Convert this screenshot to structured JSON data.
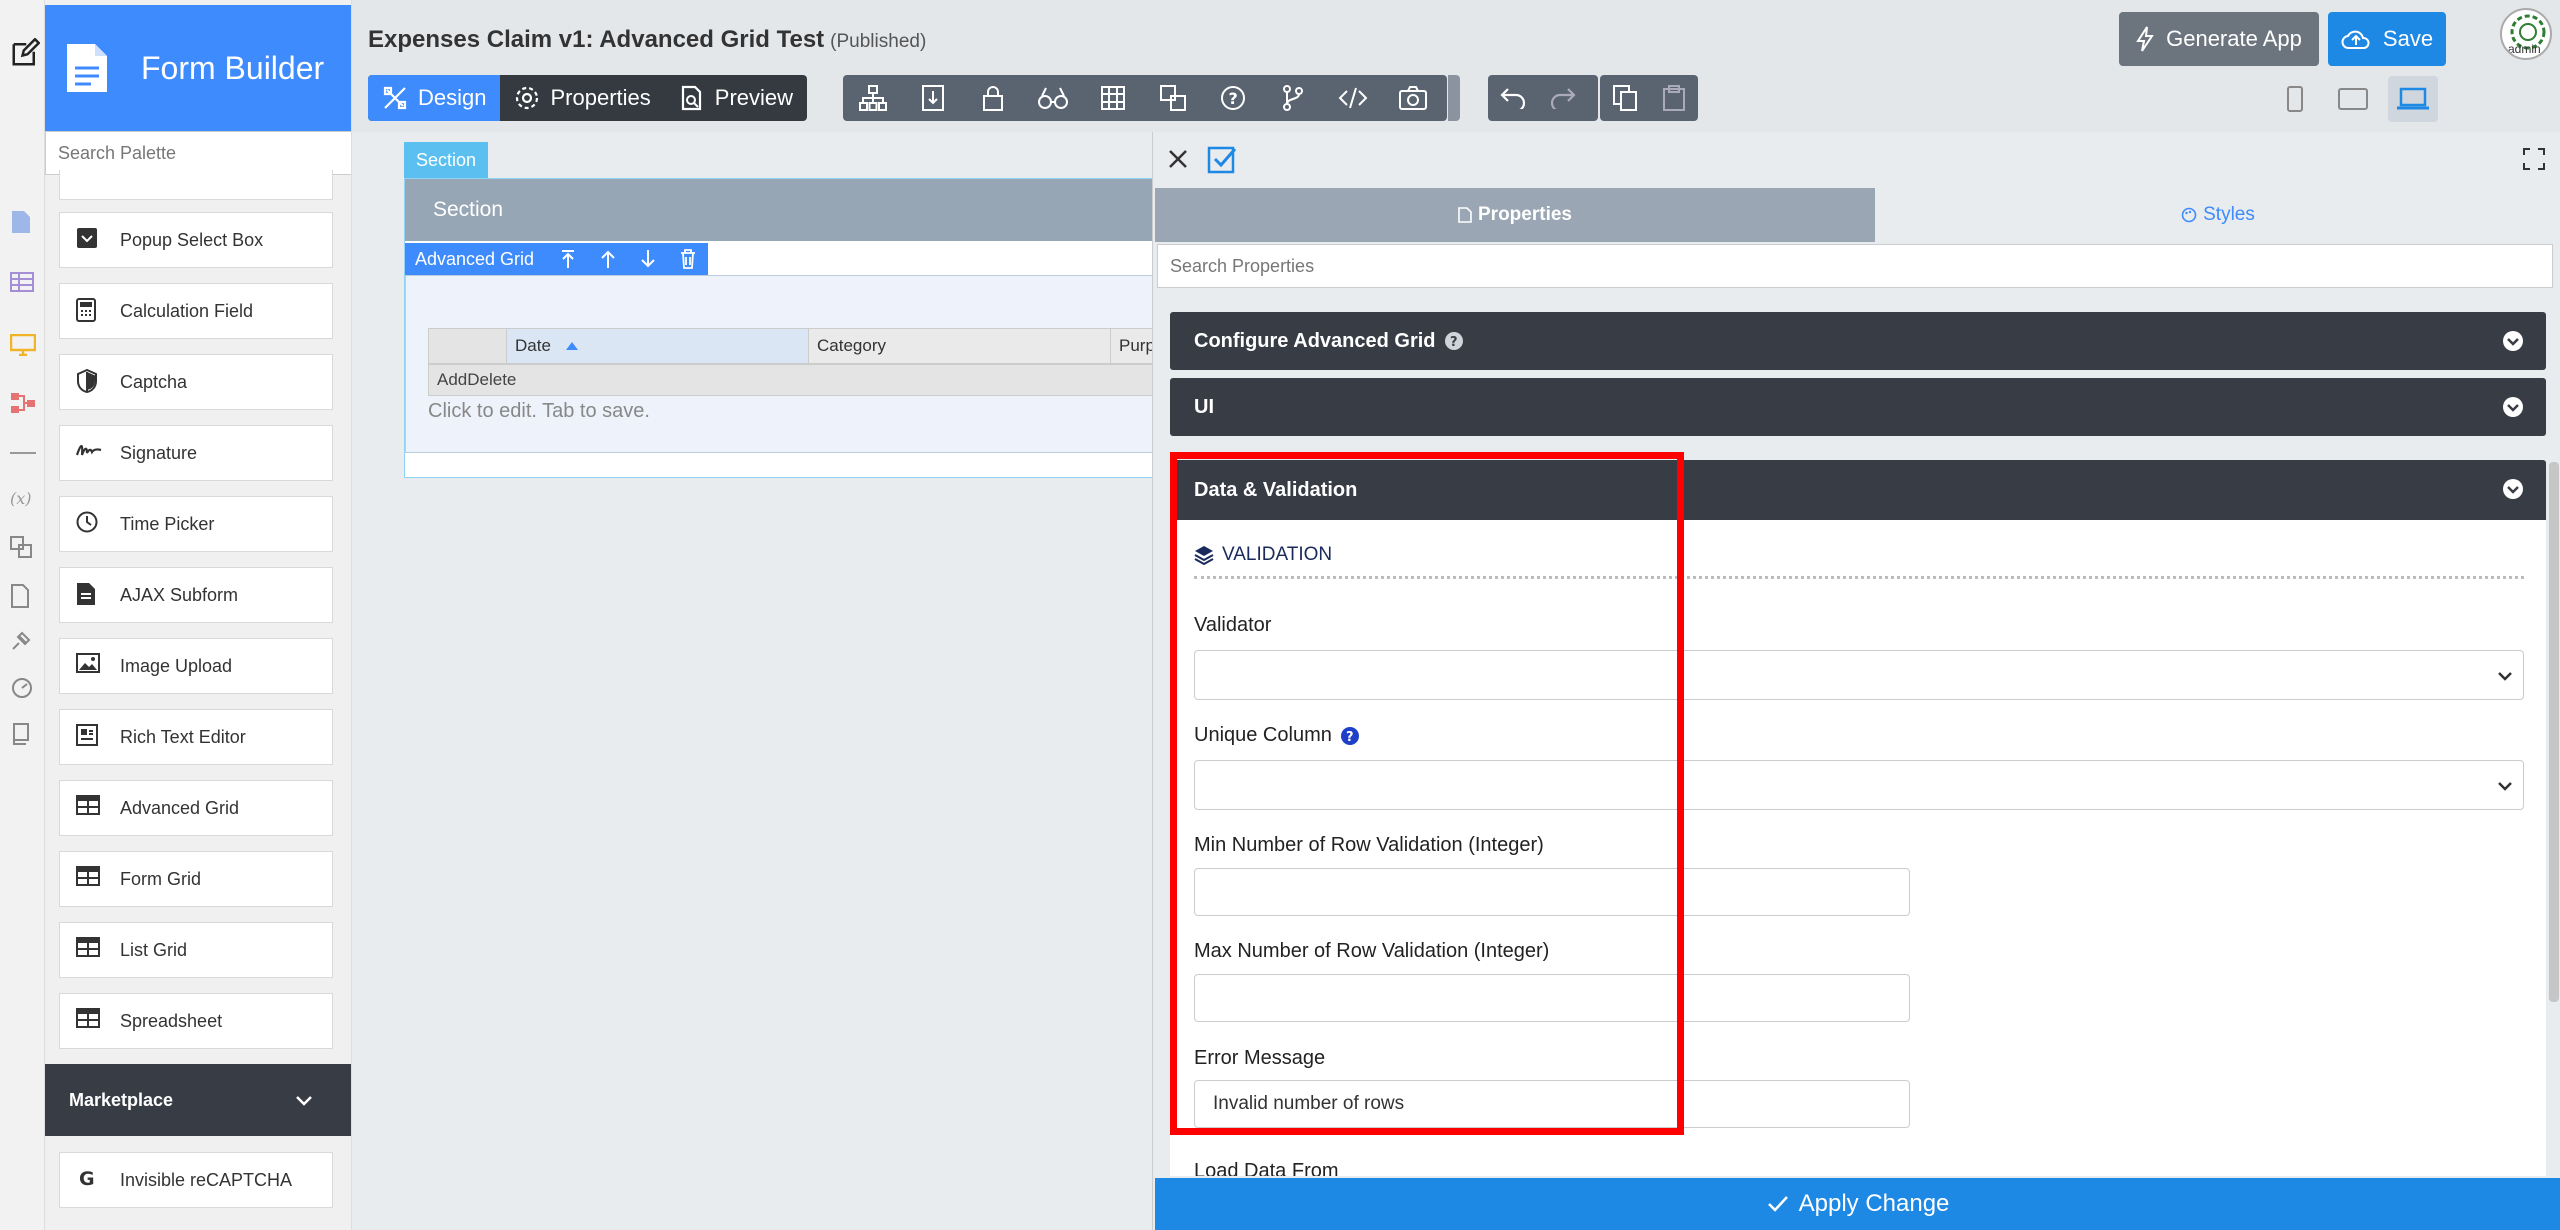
{
  "palette": {
    "title": "Form Builder",
    "search_placeholder": "Search Palette",
    "items": [
      {
        "label": "Popup Select Box",
        "icon": "popup-select-icon"
      },
      {
        "label": "Calculation Field",
        "icon": "calculator-icon"
      },
      {
        "label": "Captcha",
        "icon": "shield-icon"
      },
      {
        "label": "Signature",
        "icon": "signature-icon"
      },
      {
        "label": "Time Picker",
        "icon": "clock-icon"
      },
      {
        "label": "AJAX Subform",
        "icon": "file-icon"
      },
      {
        "label": "Image Upload",
        "icon": "image-icon"
      },
      {
        "label": "Rich Text Editor",
        "icon": "rich-text-icon"
      },
      {
        "label": "Advanced Grid",
        "icon": "table-icon"
      },
      {
        "label": "Form Grid",
        "icon": "table-icon"
      },
      {
        "label": "List Grid",
        "icon": "table-icon"
      },
      {
        "label": "Spreadsheet",
        "icon": "table-icon"
      }
    ],
    "marketplace_label": "Marketplace",
    "marketplace_items": [
      {
        "label": "Invisible reCAPTCHA",
        "icon": "google-icon"
      }
    ]
  },
  "header": {
    "title": "Expenses Claim v1: Advanced Grid Test",
    "status": "(Published)",
    "modes": [
      "Design",
      "Properties",
      "Preview"
    ],
    "generate_label": "Generate App",
    "save_label": "Save",
    "avatar_label": "admin"
  },
  "canvas": {
    "section_tab": "Section",
    "section_header": "Section",
    "element_label": "Advanced Grid",
    "grid_columns": [
      "Date",
      "Category",
      "Purp"
    ],
    "grid_add_delete": "AddDelete",
    "grid_hint": "Click to edit. Tab to save."
  },
  "properties": {
    "tab_properties": "Properties",
    "tab_styles": "Styles",
    "search_placeholder": "Search Properties",
    "accordion": [
      "Configure Advanced Grid",
      "UI",
      "Data & Validation"
    ],
    "validation_heading": "VALIDATION",
    "fields": {
      "validator_label": "Validator",
      "unique_column_label": "Unique Column",
      "min_rows_label": "Min Number of Row Validation (Integer)",
      "max_rows_label": "Max Number of Row Validation (Integer)",
      "error_message_label": "Error Message",
      "error_message_value": "Invalid number of rows",
      "load_data_label": "Load Data From"
    },
    "apply_label": "Apply Change"
  },
  "colors": {
    "primary": "#3d8bfd",
    "dark": "#383d45",
    "highlight": "#ff0000"
  }
}
